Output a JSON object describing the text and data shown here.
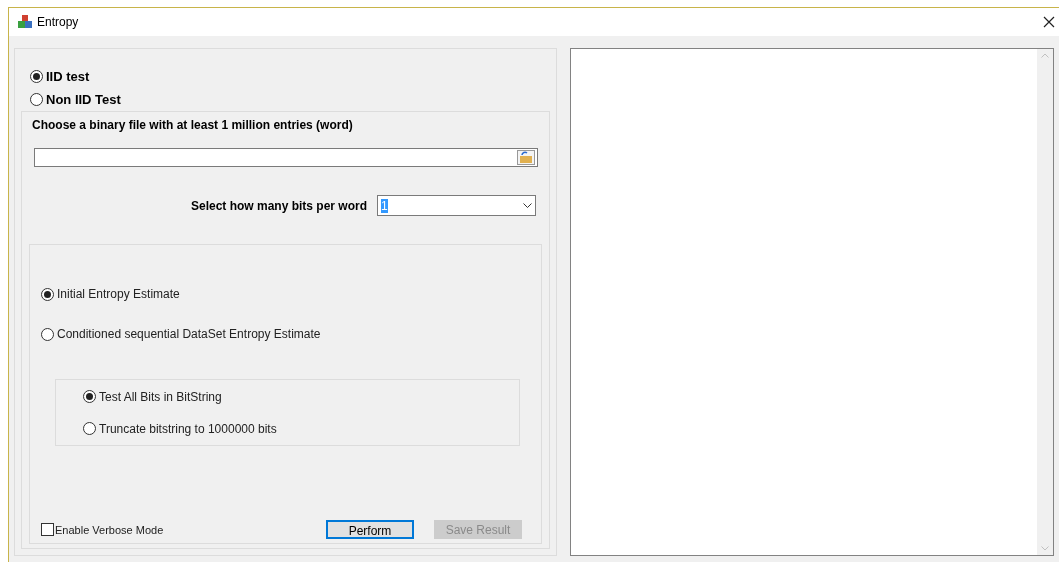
{
  "window": {
    "title": "Entropy"
  },
  "test_type": [
    {
      "label": "IID test",
      "selected": true
    },
    {
      "label": "Non IID Test",
      "selected": false
    }
  ],
  "file": {
    "label": "Choose a binary file with at least 1 million entries (word)"
  },
  "bits_per_word": {
    "label": "Select how many bits per word",
    "value": "1"
  },
  "estimate": [
    {
      "label": "Initial Entropy Estimate",
      "selected": true
    },
    {
      "label": "Conditioned sequential DataSet Entropy Estimate",
      "selected": false
    }
  ],
  "bitstring": [
    {
      "label": "Test All Bits in BitString",
      "selected": true
    },
    {
      "label": "Truncate bitstring to 1000000 bits",
      "selected": false
    }
  ],
  "verbose": {
    "label": "Enable Verbose Mode",
    "checked": false
  },
  "buttons": [
    {
      "label": "Perform",
      "disabled": false,
      "focused": true
    },
    {
      "label": "Save Result",
      "disabled": true,
      "focused": false
    }
  ]
}
